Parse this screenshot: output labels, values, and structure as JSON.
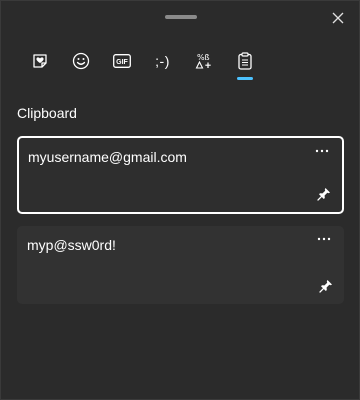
{
  "window": {
    "close_icon": "close-icon"
  },
  "tabs": [
    {
      "name": "stickers-tab",
      "icon": "heart-sticker-icon"
    },
    {
      "name": "emoji-tab",
      "icon": "smiley-icon"
    },
    {
      "name": "gif-tab",
      "icon": "gif-icon",
      "label": "GIF"
    },
    {
      "name": "kaomoji-tab",
      "icon": "kaomoji-icon",
      "label": ";-)"
    },
    {
      "name": "symbols-tab",
      "icon": "symbols-icon"
    },
    {
      "name": "clipboard-tab",
      "icon": "clipboard-icon",
      "selected": true
    }
  ],
  "clipboard": {
    "title": "Clipboard",
    "items": [
      {
        "text": "myusername@gmail.com",
        "selected": true
      },
      {
        "text": "myp@ssw0rd!",
        "selected": false
      }
    ],
    "more_label": "···"
  },
  "colors": {
    "background": "#2b2b2b",
    "card": "#323232",
    "accent": "#4cc2ff",
    "text": "#ffffff"
  }
}
